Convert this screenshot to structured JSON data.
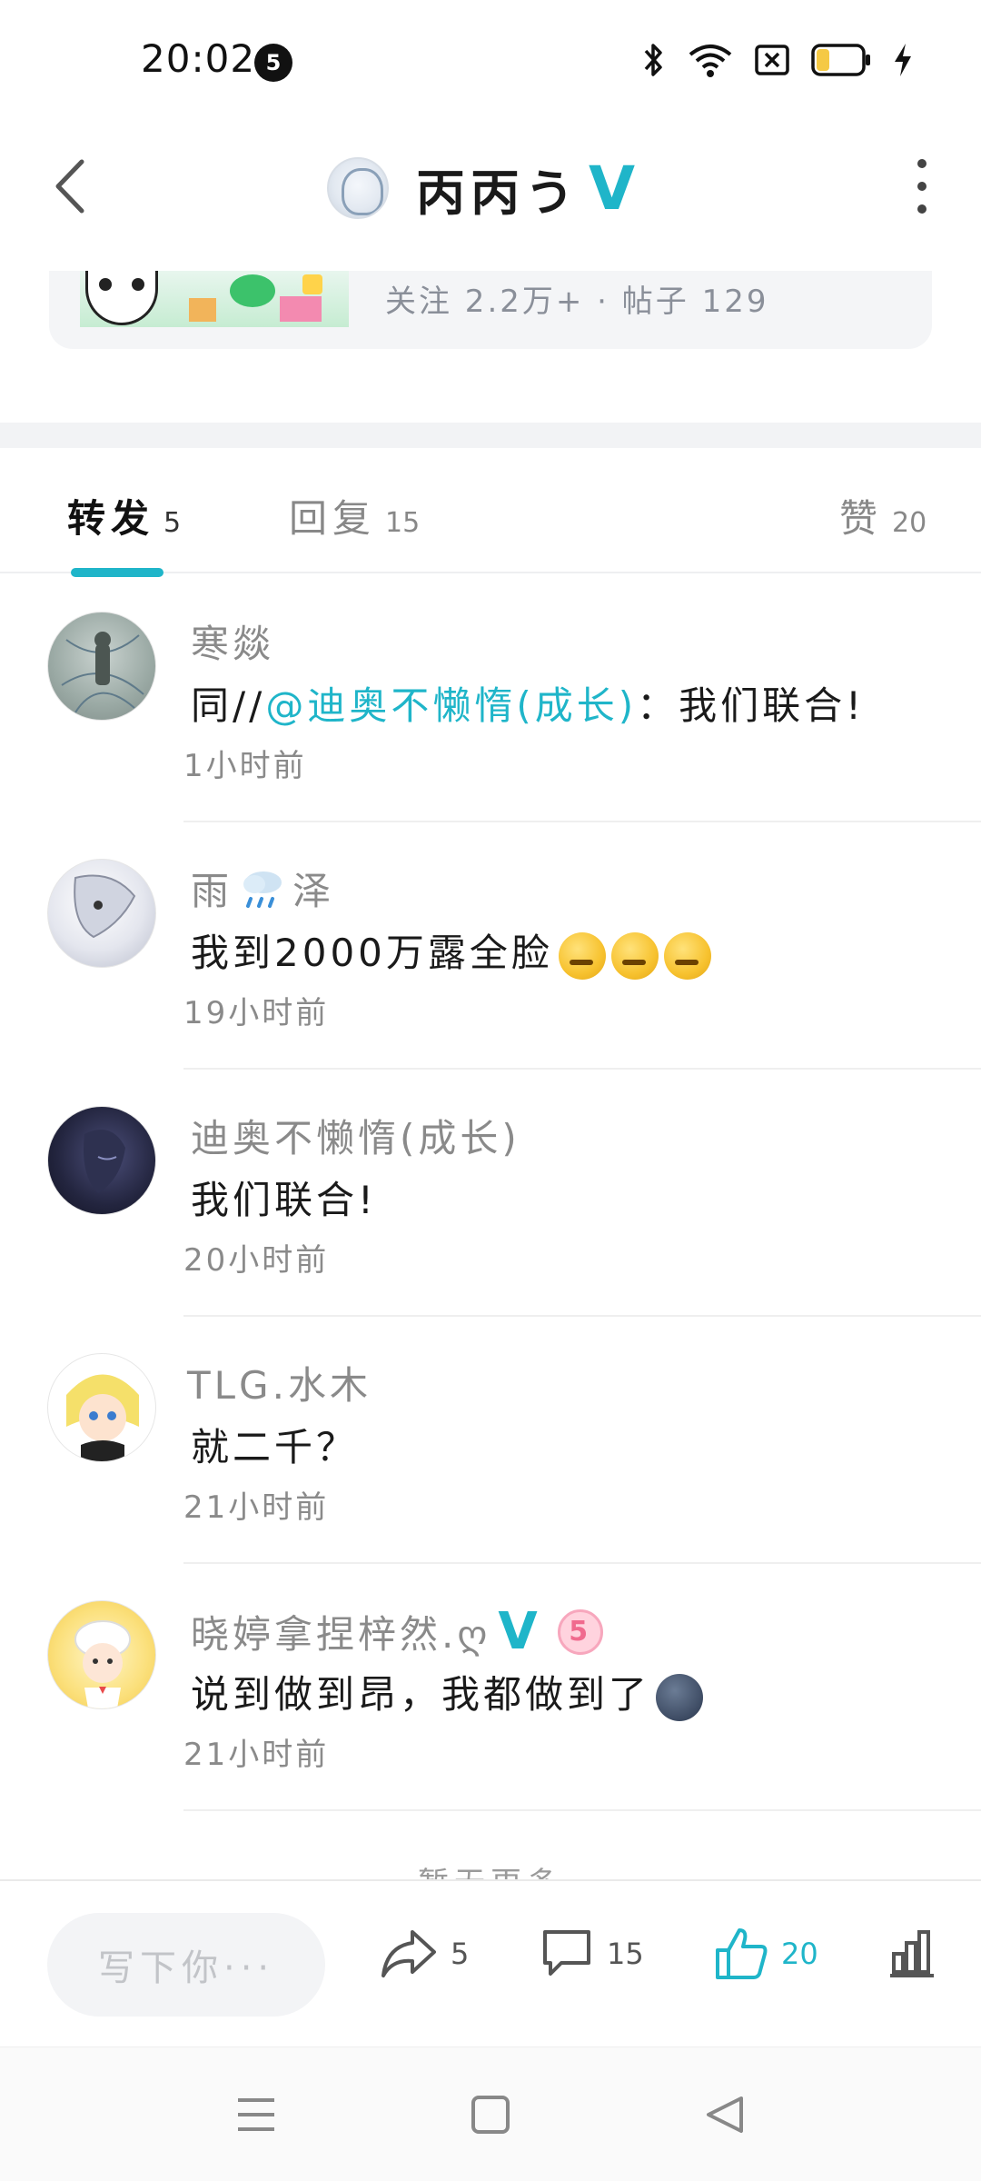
{
  "status_bar": {
    "time": "20:02",
    "badge": "5",
    "icons": [
      "bluetooth-icon",
      "wifi-icon",
      "sim-off-icon",
      "battery-icon",
      "charging-icon"
    ]
  },
  "header": {
    "title": "丙丙う",
    "verified": "V"
  },
  "forum": {
    "stats": "关注 2.2万+ · 帖子 129"
  },
  "tabs": [
    {
      "label": "转发",
      "count": "5"
    },
    {
      "label": "回复",
      "count": "15"
    },
    {
      "label": "赞",
      "count": "20"
    }
  ],
  "comments": [
    {
      "name": "寒燚",
      "content_prefix": "同//",
      "mention": "@迪奥不懒惰(成长)",
      "content_suffix": "：我们联合!",
      "time": "1小时前"
    },
    {
      "name_a": "雨",
      "name_b": "泽",
      "content": "我到2000万露全脸",
      "time": "19小时前"
    },
    {
      "name": "迪奥不懒惰(成长)",
      "content": "我们联合!",
      "time": "20小时前"
    },
    {
      "name": "TLG.水木",
      "content": "就二千？",
      "time": "21小时前"
    },
    {
      "name": "晓婷拿捏梓然.ღ",
      "verified": "V",
      "level": "5",
      "content": "说到做到昂，我都做到了",
      "time": "21小时前"
    }
  ],
  "footer_hint": "暂无更多",
  "action_bar": {
    "input_placeholder": "写下你···",
    "share_count": "5",
    "comment_count": "15",
    "like_count": "20"
  },
  "colors": {
    "accent": "#1fb5c9",
    "text_primary": "#1a1a1a",
    "text_secondary": "#8a8a8a"
  }
}
